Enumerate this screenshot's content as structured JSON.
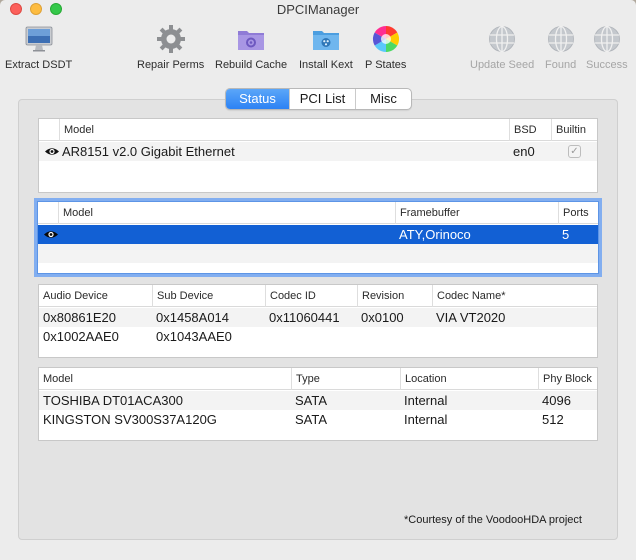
{
  "window": {
    "title": "DPCIManager"
  },
  "toolbar": {
    "items": [
      {
        "label": "Extract DSDT",
        "icon": "imac-icon",
        "enabled": true
      },
      {
        "label": "Repair Perms",
        "icon": "gear-icon",
        "enabled": true
      },
      {
        "label": "Rebuild Cache",
        "icon": "folder-gear-icon",
        "enabled": true
      },
      {
        "label": "Install Kext",
        "icon": "folder-drive-icon",
        "enabled": true
      },
      {
        "label": "P States",
        "icon": "color-wheel-icon",
        "enabled": true
      },
      {
        "label": "Update Seed",
        "icon": "globe-icon",
        "enabled": false
      },
      {
        "label": "Found",
        "icon": "globe-icon",
        "enabled": false
      },
      {
        "label": "Success",
        "icon": "globe-icon",
        "enabled": false
      }
    ]
  },
  "tabs": [
    {
      "label": "Status",
      "active": true
    },
    {
      "label": "PCI List",
      "active": false
    },
    {
      "label": "Misc",
      "active": false
    }
  ],
  "network_table": {
    "headers": [
      "Model",
      "BSD",
      "Builtin"
    ],
    "rows": [
      {
        "model": "AR8151 v2.0 Gigabit Ethernet",
        "bsd": "en0",
        "builtin": true
      }
    ]
  },
  "graphics_table": {
    "headers": [
      "Model",
      "Framebuffer",
      "Ports"
    ],
    "rows": [
      {
        "model": "",
        "framebuffer": "ATY,Orinoco",
        "ports": "5"
      }
    ]
  },
  "audio_table": {
    "headers": [
      "Audio Device",
      "Sub Device",
      "Codec ID",
      "Revision",
      "Codec Name*"
    ],
    "rows": [
      {
        "audio_device": "0x80861E20",
        "sub_device": "0x1458A014",
        "codec_id": "0x11060441",
        "revision": "0x0100",
        "codec_name": "VIA VT2020"
      },
      {
        "audio_device": "0x1002AAE0",
        "sub_device": "0x1043AAE0",
        "codec_id": "",
        "revision": "",
        "codec_name": ""
      }
    ]
  },
  "storage_table": {
    "headers": [
      "Model",
      "Type",
      "Location",
      "Phy Block"
    ],
    "rows": [
      {
        "model": "TOSHIBA DT01ACA300",
        "type": "SATA",
        "location": "Internal",
        "phy_block": "4096"
      },
      {
        "model": "KINGSTON SV300S37A120G",
        "type": "SATA",
        "location": "Internal",
        "phy_block": "512"
      }
    ]
  },
  "footnote": "*Courtesy of the VoodooHDA project",
  "colors": {
    "selection": "#1260d4",
    "tab_active": "#2c82f4"
  }
}
